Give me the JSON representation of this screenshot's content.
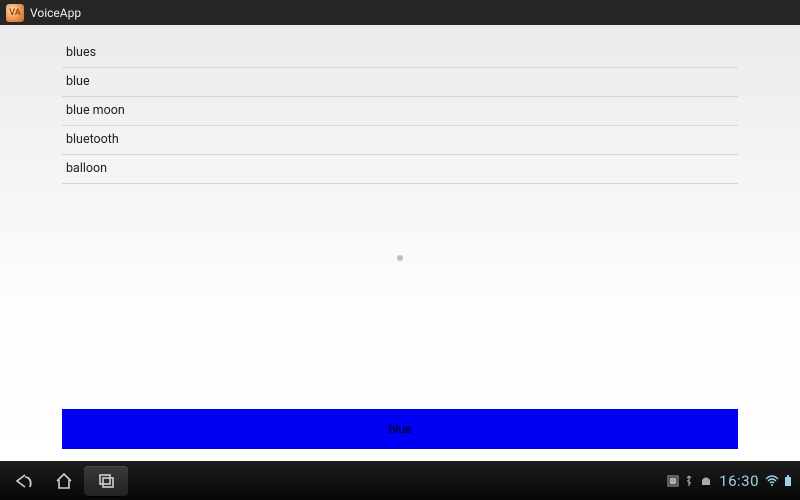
{
  "actionbar": {
    "title": "VoiceApp",
    "icon_letters": "VA"
  },
  "list": {
    "items": [
      {
        "label": "blues"
      },
      {
        "label": "blue"
      },
      {
        "label": "blue moon"
      },
      {
        "label": "bluetooth"
      },
      {
        "label": "balloon"
      }
    ]
  },
  "result_bar": {
    "label": "blue",
    "color": "#0000f5"
  },
  "statusbar": {
    "time": "16:30"
  }
}
